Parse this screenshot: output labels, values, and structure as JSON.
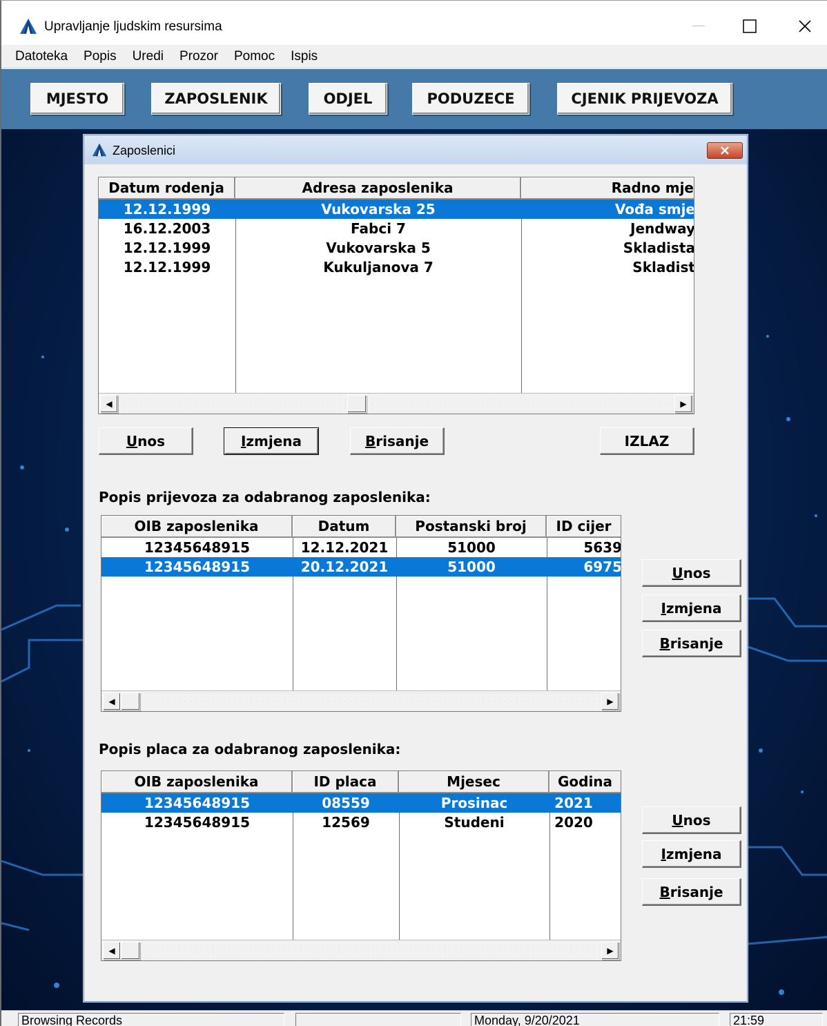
{
  "window": {
    "title": "Upravljanje ljudskim resursima"
  },
  "menu": [
    "Datoteka",
    "Popis",
    "Uredi",
    "Prozor",
    "Pomoc",
    "Ispis"
  ],
  "toolbar": [
    "MJESTO",
    "ZAPOSLENIK",
    "ODJEL",
    "PODUZECE",
    "CJENIK PRIJEVOZA"
  ],
  "dialog": {
    "title": "Zaposlenici",
    "employees": {
      "headers": [
        "Datum rodenja",
        "Adresa zaposlenika",
        "Radno mje"
      ],
      "rows": [
        [
          "12.12.1999",
          "Vukovarska 25",
          "Vođa smje"
        ],
        [
          "16.12.2003",
          "Fabci 7",
          "Jendway"
        ],
        [
          "12.12.1999",
          "Vukovarska 5",
          "Skladista"
        ],
        [
          "12.12.1999",
          "Kukuljanova 7",
          "Skladist"
        ]
      ],
      "selected_row": 0
    },
    "buttons": {
      "unos_u": "U",
      "unos": "nos",
      "izmjena_u": "I",
      "izmjena": "zmjena",
      "brisanje_u": "B",
      "brisanje": "risanje",
      "izlaz": "IZLAZ"
    },
    "transport_label": "Popis prijevoza za odabranog zaposlenika:",
    "transport": {
      "headers": [
        "OIB zaposlenika",
        "Datum",
        "Postanski broj",
        "ID cijer"
      ],
      "rows": [
        [
          "12345648915",
          "12.12.2021",
          "51000",
          "5639"
        ],
        [
          "12345648915",
          "20.12.2021",
          "51000",
          "6975"
        ]
      ],
      "selected_row": 1
    },
    "salary_label": "Popis placa za odabranog zaposlenika:",
    "salary": {
      "headers": [
        "OIB zaposlenika",
        "ID placa",
        "Mjesec",
        "Godina"
      ],
      "rows": [
        [
          "12345648915",
          "08559",
          "Prosinac",
          "2021"
        ],
        [
          "12345648915",
          "12569",
          "Studeni",
          "2020"
        ]
      ],
      "selected_row": 0
    }
  },
  "status": {
    "mode": "Browsing Records",
    "empty": "",
    "date": "Monday, 9/20/2021",
    "time": "21:59"
  },
  "colors": {
    "toolbar": "#4479a8",
    "selection": "#0a78d7",
    "desktop": "#062350"
  },
  "icons": {
    "app": "a-triangle-logo-icon",
    "minimize": "minimize-icon",
    "maximize": "maximize-icon",
    "close": "close-icon"
  }
}
